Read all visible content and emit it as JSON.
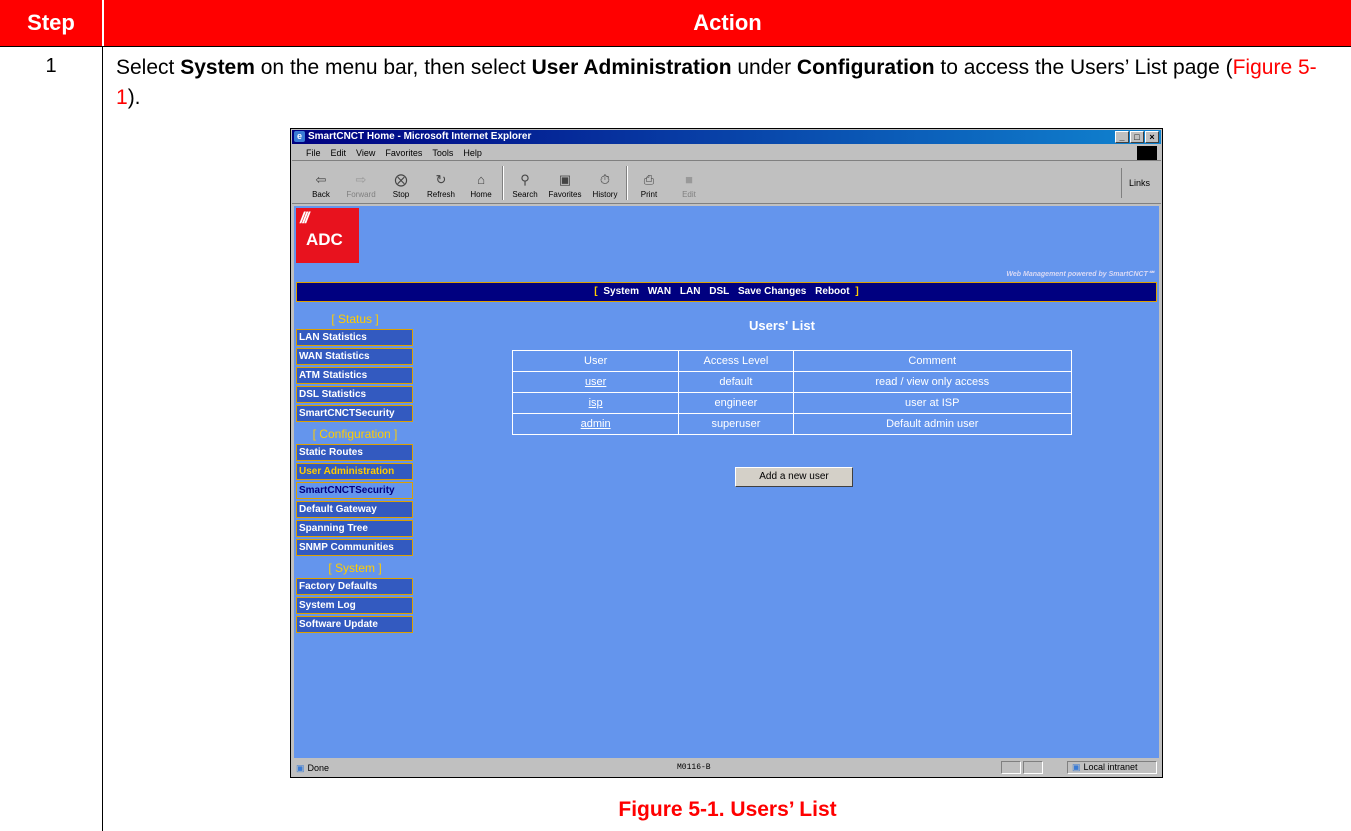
{
  "header": {
    "step": "Step",
    "action": "Action"
  },
  "step_number": "1",
  "instruction": {
    "p1": "Select ",
    "system": "System",
    "p2": " on the menu bar, then select ",
    "user_admin": "User Administration",
    "p3": " under ",
    "configuration": "Configuration",
    "p4": " to access the Users’ List page (",
    "figref": "Figure 5-1",
    "p5": ")."
  },
  "caption": "Figure 5-1. Users’ List",
  "browser": {
    "title": "SmartCNCT Home - Microsoft Internet Explorer",
    "menu": [
      "File",
      "Edit",
      "View",
      "Favorites",
      "Tools",
      "Help"
    ],
    "toolbar": [
      {
        "label": "Back",
        "icon": "back-arrow-icon"
      },
      {
        "label": "Forward",
        "icon": "forward-arrow-icon"
      },
      {
        "label": "Stop",
        "icon": "stop-icon"
      },
      {
        "label": "Refresh",
        "icon": "refresh-icon"
      },
      {
        "label": "Home",
        "icon": "home-icon"
      },
      {
        "label": "Search",
        "icon": "search-icon"
      },
      {
        "label": "Favorites",
        "icon": "favorites-icon"
      },
      {
        "label": "History",
        "icon": "history-icon"
      },
      {
        "label": "Print",
        "icon": "print-icon"
      },
      {
        "label": "Edit",
        "icon": "edit-icon"
      }
    ],
    "links": "Links",
    "status": {
      "text": "Done",
      "center": "M0116-B",
      "zone": "Local intranet"
    }
  },
  "page": {
    "logo": "ADC",
    "powered": "Web Management powered by SmartCNCT℠",
    "nav": [
      "System",
      "WAN",
      "LAN",
      "DSL",
      "Save Changes",
      "Reboot"
    ],
    "sidebar": {
      "status_head": "[ Status ]",
      "status_items": [
        "LAN Statistics",
        "WAN Statistics",
        "ATM Statistics",
        "DSL Statistics",
        "SmartCNCTSecurity"
      ],
      "config_head": "[ Configuration ]",
      "config_items": [
        "Static Routes",
        "User Administration",
        "SmartCNCTSecurity",
        "Default Gateway",
        "Spanning Tree",
        "SNMP Communities"
      ],
      "system_head": "[ System ]",
      "system_items": [
        "Factory Defaults",
        "System Log",
        "Software Update"
      ]
    },
    "users_title": "Users' List",
    "table": {
      "headers": [
        "User",
        "Access Level",
        "Comment"
      ],
      "rows": [
        [
          "user",
          "default",
          "read / view only access"
        ],
        [
          "isp",
          "engineer",
          "user at ISP"
        ],
        [
          "admin",
          "superuser",
          "Default admin user"
        ]
      ]
    },
    "add_button": "Add a new user"
  },
  "colors": {
    "header_red": "#ff0000",
    "page_bg": "#6495ed",
    "nav_bg": "#000080",
    "accent_gold": "#ffcc00"
  }
}
